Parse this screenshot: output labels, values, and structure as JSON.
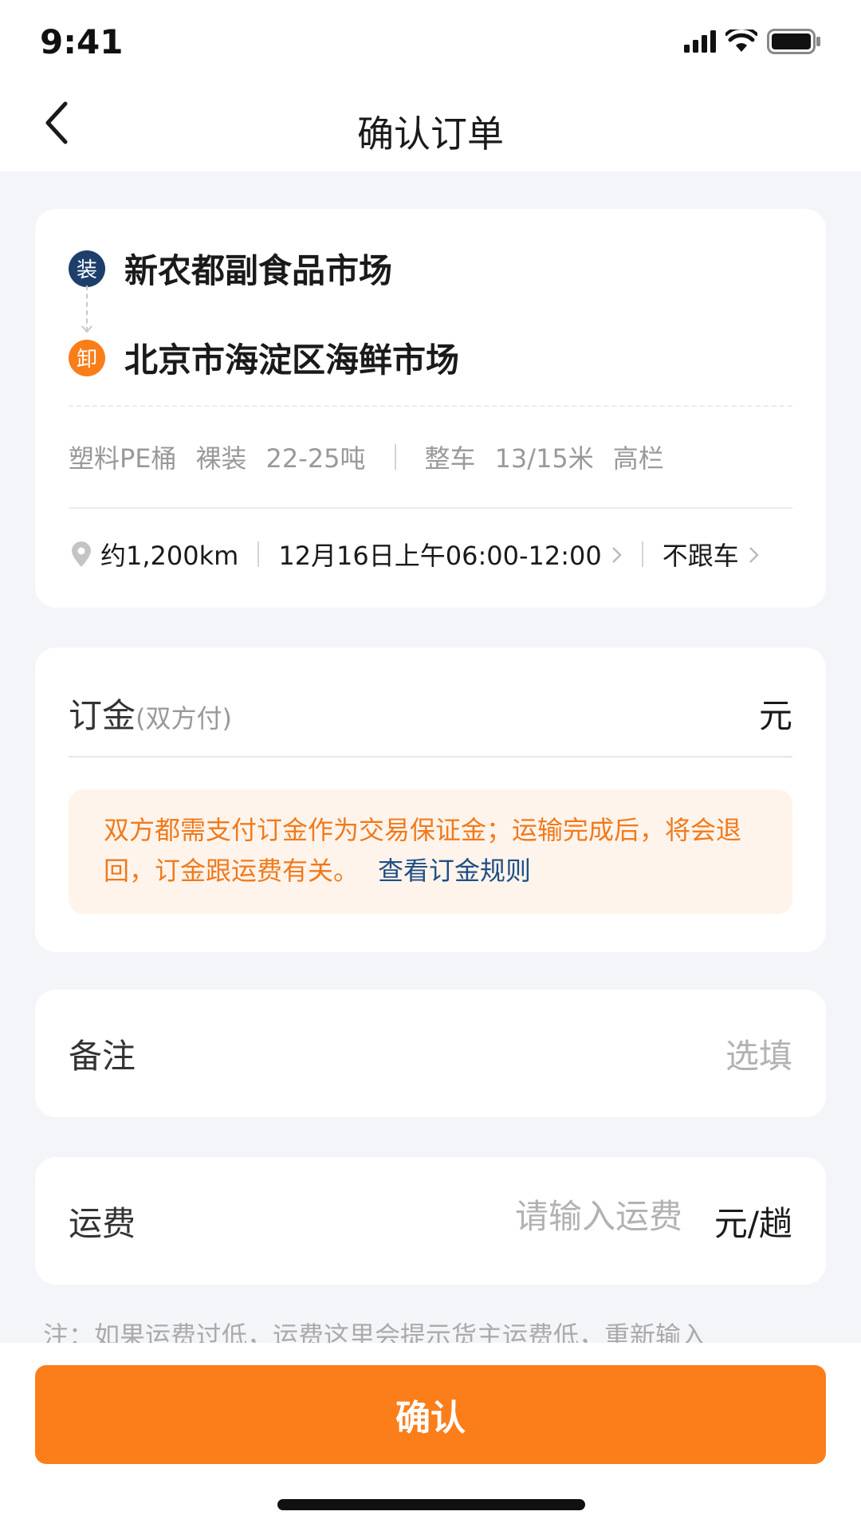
{
  "status_bar": {
    "time": "9:41"
  },
  "nav": {
    "title": "确认订单",
    "back_icon": "chevron-left-icon"
  },
  "route": {
    "load": {
      "badge": "装",
      "name": "新农都副食品市场"
    },
    "unload": {
      "badge": "卸",
      "name": "北京市海淀区海鲜市场"
    }
  },
  "specs": {
    "cargo_type": "塑料PE桶",
    "packing": "裸装",
    "weight": "22-25吨",
    "vehicle_mode": "整车",
    "vehicle_length": "13/15米",
    "vehicle_type": "高栏"
  },
  "trip": {
    "distance": "约1,200km",
    "load_time": "12月16日上午06:00-12:00",
    "follow": "不跟车"
  },
  "deposit": {
    "label": "订金",
    "sub_label": "(双方付)",
    "unit": "元",
    "notice": "双方都需支付订金作为交易保证金；运输完成后，将会退回，订金跟运费有关。",
    "rules_link": "查看订金规则"
  },
  "remark": {
    "label": "备注",
    "placeholder": "选填"
  },
  "freight": {
    "label": "运费",
    "placeholder": "请输入运费",
    "unit": "元/趟"
  },
  "footnote": "注：如果运费过低，运费这里会提示货主运费低，重新输入",
  "confirm": {
    "label": "确认"
  },
  "colors": {
    "accent": "#fb7e1a",
    "load_badge": "#1e3f6b",
    "link": "#1e4f86",
    "notice_bg": "#fff4ec"
  }
}
